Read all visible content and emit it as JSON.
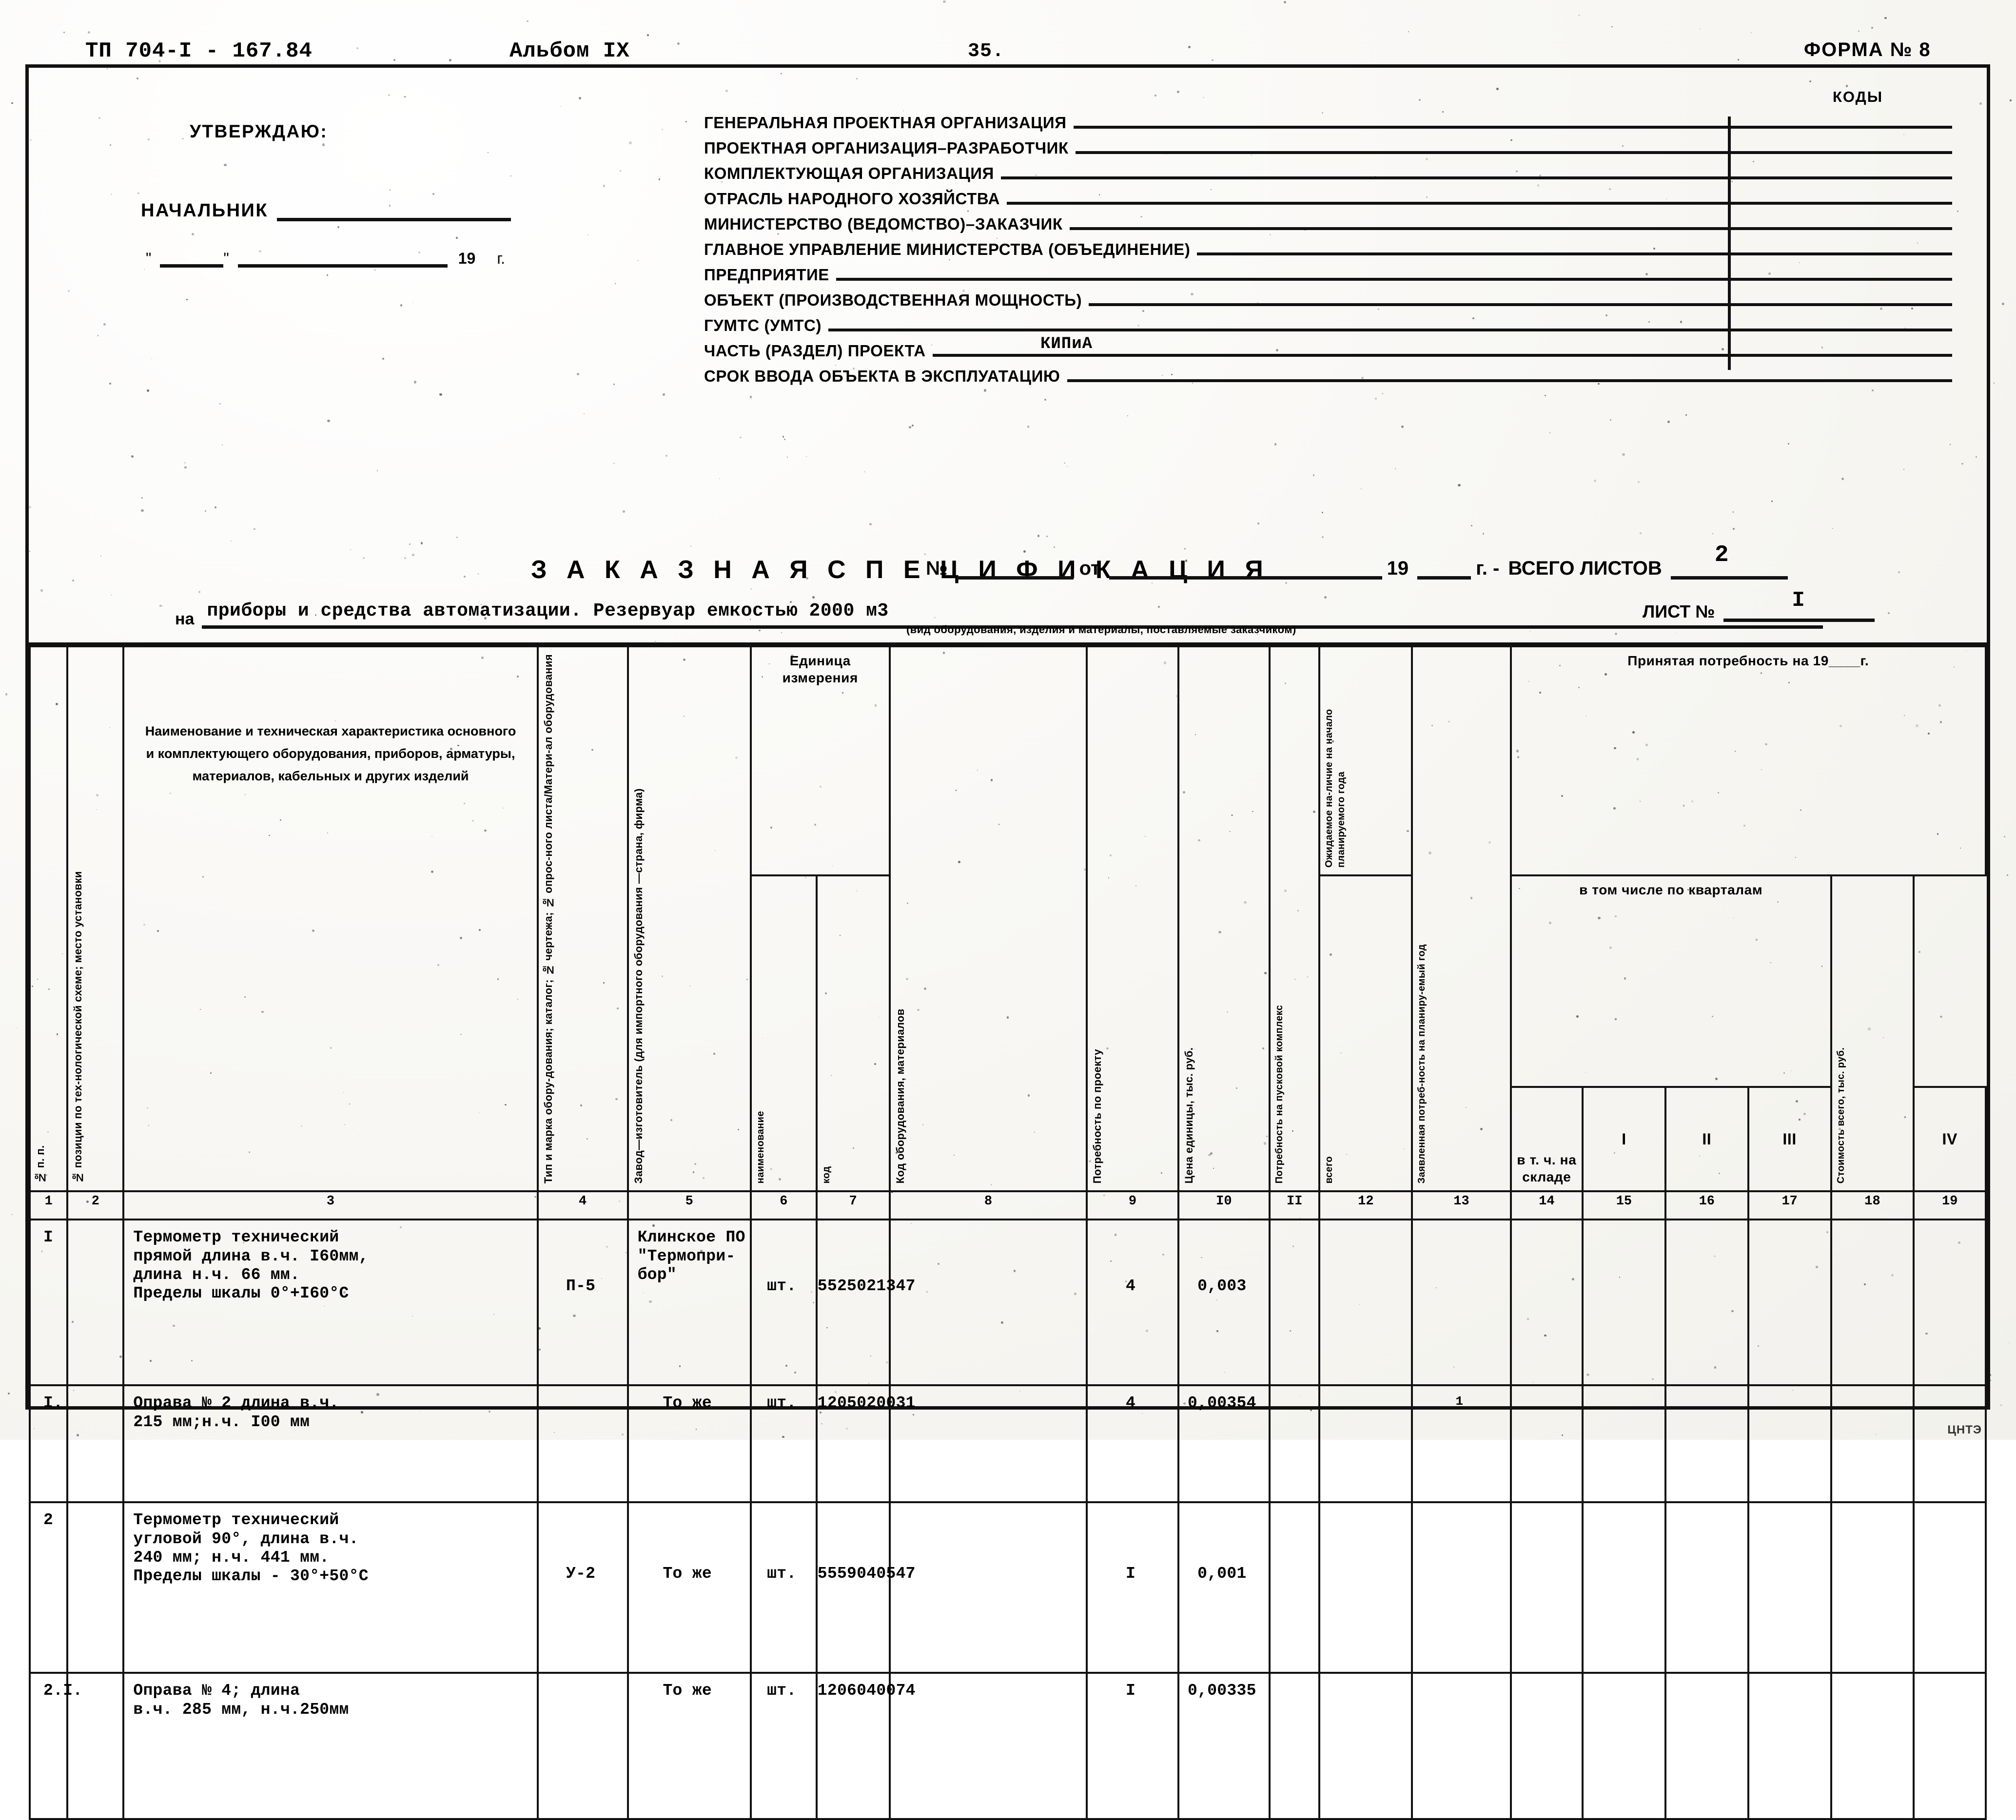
{
  "header": {
    "document_code": "ТП 704-I - 167.84",
    "album": "Альбом IX",
    "page_number": "35.",
    "form_number": "ФОРМА № 8",
    "codes_label": "КОДЫ"
  },
  "approval": {
    "approve_label": "УТВЕРЖДАЮ:",
    "chief_label": "НАЧАЛЬНИК",
    "date_quote_open": "\"",
    "date_quote_close": "\"",
    "year_prefix": "19",
    "year_suffix": "г."
  },
  "fields": [
    {
      "label": "ГЕНЕРАЛЬНАЯ ПРОЕКТНАЯ ОРГАНИЗАЦИЯ",
      "value": ""
    },
    {
      "label": "ПРОЕКТНАЯ ОРГАНИЗАЦИЯ–РАЗРАБОТЧИК",
      "value": ""
    },
    {
      "label": "КОМПЛЕКТУЮЩАЯ ОРГАНИЗАЦИЯ",
      "value": ""
    },
    {
      "label": "ОТРАСЛЬ НАРОДНОГО ХОЗЯЙСТВА",
      "value": ""
    },
    {
      "label": "МИНИСТЕРСТВО (ВЕДОМСТВО)–ЗАКАЗЧИК",
      "value": ""
    },
    {
      "label": "ГЛАВНОЕ УПРАВЛЕНИЕ МИНИСТЕРСТВА (ОБЪЕДИНЕНИЕ)",
      "value": ""
    },
    {
      "label": "ПРЕДПРИЯТИЕ",
      "value": ""
    },
    {
      "label": "ОБЪЕКТ (ПРОИЗВОДСТВЕННАЯ МОЩНОСТЬ)",
      "value": ""
    },
    {
      "label": "ГУМТС (УМТС)",
      "value": ""
    },
    {
      "label": "ЧАСТЬ (РАЗДЕЛ) ПРОЕКТА",
      "value": "КИПиА"
    },
    {
      "label": "СРОК ВВОДА ОБЪЕКТА В ЭКСПЛУАТАЦИЮ",
      "value": ""
    }
  ],
  "title": {
    "main": "З А К А З Н А Я   С П Е Ц И Ф И К А Ц И Я",
    "number_label": "№",
    "number_value": "",
    "from_label": "от",
    "from_value": "",
    "year_prefix": "19",
    "year_suffix": "г. -",
    "total_sheets_label": "ВСЕГО ЛИСТОВ",
    "total_sheets_value": "2",
    "on_label": "на",
    "subject": "приборы и средства автоматизации. Резервуар емкостью 2000 м3",
    "caption": "(вид оборудования, изделия и материалы, поставляемые заказчиком)",
    "sheet_label": "ЛИСТ №",
    "sheet_value": "I"
  },
  "table": {
    "headers": {
      "c1": "№ п. п.",
      "c2": "№ позиции по тех-нологической схеме; место установки",
      "c3": "Наименование  и  техническая характеристика основного и комплектующего оборудования, приборов, арматуры, материалов, кабельных и других изделий",
      "c4": "Тип и марка обору-дования; каталог; № чертежа; № опрос-ного листа/Матери-ал оборудования",
      "c5": "Завод—изготовитель (для импортного оборудования —страна, фирма)",
      "c6_group": "Единица измерения",
      "c6": "наименование",
      "c7": "код",
      "c8": "Код оборудования, материалов",
      "c9": "Потребность по проекту",
      "c10": "Цена единицы, тыс. руб.",
      "c11": "Потребность на пусковой комплекс",
      "c12": "Ожидаемое на-личие на начало планируемого года",
      "c12sub": "в т. ч. на складе",
      "c13": "Заявленная потреб-ность на планиру-емый год",
      "c14group": "Принятая потребность на 19____г.",
      "c14": "всего",
      "quarters_group": "в том числе по кварталам",
      "c15": "I",
      "c16": "II",
      "c17": "III",
      "c18": "IV",
      "c19": "Стоимость всего, тыс. руб."
    },
    "column_numbers": [
      "1",
      "2",
      "3",
      "4",
      "5",
      "6",
      "7",
      "8",
      "9",
      "I0",
      "II",
      "12",
      "13",
      "14",
      "15",
      "16",
      "17",
      "18",
      "19"
    ],
    "rows": [
      {
        "c1": "I",
        "c2": "",
        "c3": "Термометр технический\nпрямой длина в.ч. I60мм,\nдлина н.ч. 66 мм.\nПределы шкалы 0°+I60°С",
        "c4": "П-5",
        "c5": "Клинское ПО\n\"Термопри-\nбор\"",
        "c6": "шт.",
        "c7": "5525021347",
        "c8": "",
        "c9": "4",
        "c10": "0,003",
        "c11": "",
        "c12": "",
        "c13": "",
        "c14": "",
        "c15": "",
        "c16": "",
        "c17": "",
        "c18": "",
        "c19": ""
      },
      {
        "c1": "I.",
        "c2": "",
        "c3": "Оправа № 2 длина в.ч.\n215 мм;н.ч. I00 мм",
        "c4": "",
        "c5": "То же",
        "c6": "шт.",
        "c7": "1205020031",
        "c8": "",
        "c9": "4",
        "c10": "0,00354",
        "c11": "",
        "c12": "",
        "c13": "1",
        "c14": "",
        "c15": "",
        "c16": "",
        "c17": "",
        "c18": "",
        "c19": ""
      },
      {
        "c1": "2",
        "c2": "",
        "c3": "Термометр технический\nугловой 90°, длина в.ч.\n240 мм; н.ч. 441 мм.\nПределы шкалы - 30°+50°С",
        "c4": "У-2",
        "c5": "То же",
        "c6": "шт.",
        "c7": "5559040547",
        "c8": "",
        "c9": "I",
        "c10": "0,001",
        "c11": "",
        "c12": "",
        "c13": "",
        "c14": "",
        "c15": "",
        "c16": "",
        "c17": "",
        "c18": "",
        "c19": ""
      },
      {
        "c1": "2.I.",
        "c2": "",
        "c3": "Оправа № 4; длина\nв.ч. 285 мм, н.ч.250мм",
        "c4": "",
        "c5": "То же",
        "c6": "шт.",
        "c7": "1206040074",
        "c8": "",
        "c9": "I",
        "c10": "0,00335",
        "c11": "",
        "c12": "",
        "c13": "",
        "c14": "",
        "c15": "",
        "c16": "",
        "c17": "",
        "c18": "",
        "c19": ""
      }
    ]
  },
  "footer": {
    "mark": "ЦНТЭ"
  }
}
